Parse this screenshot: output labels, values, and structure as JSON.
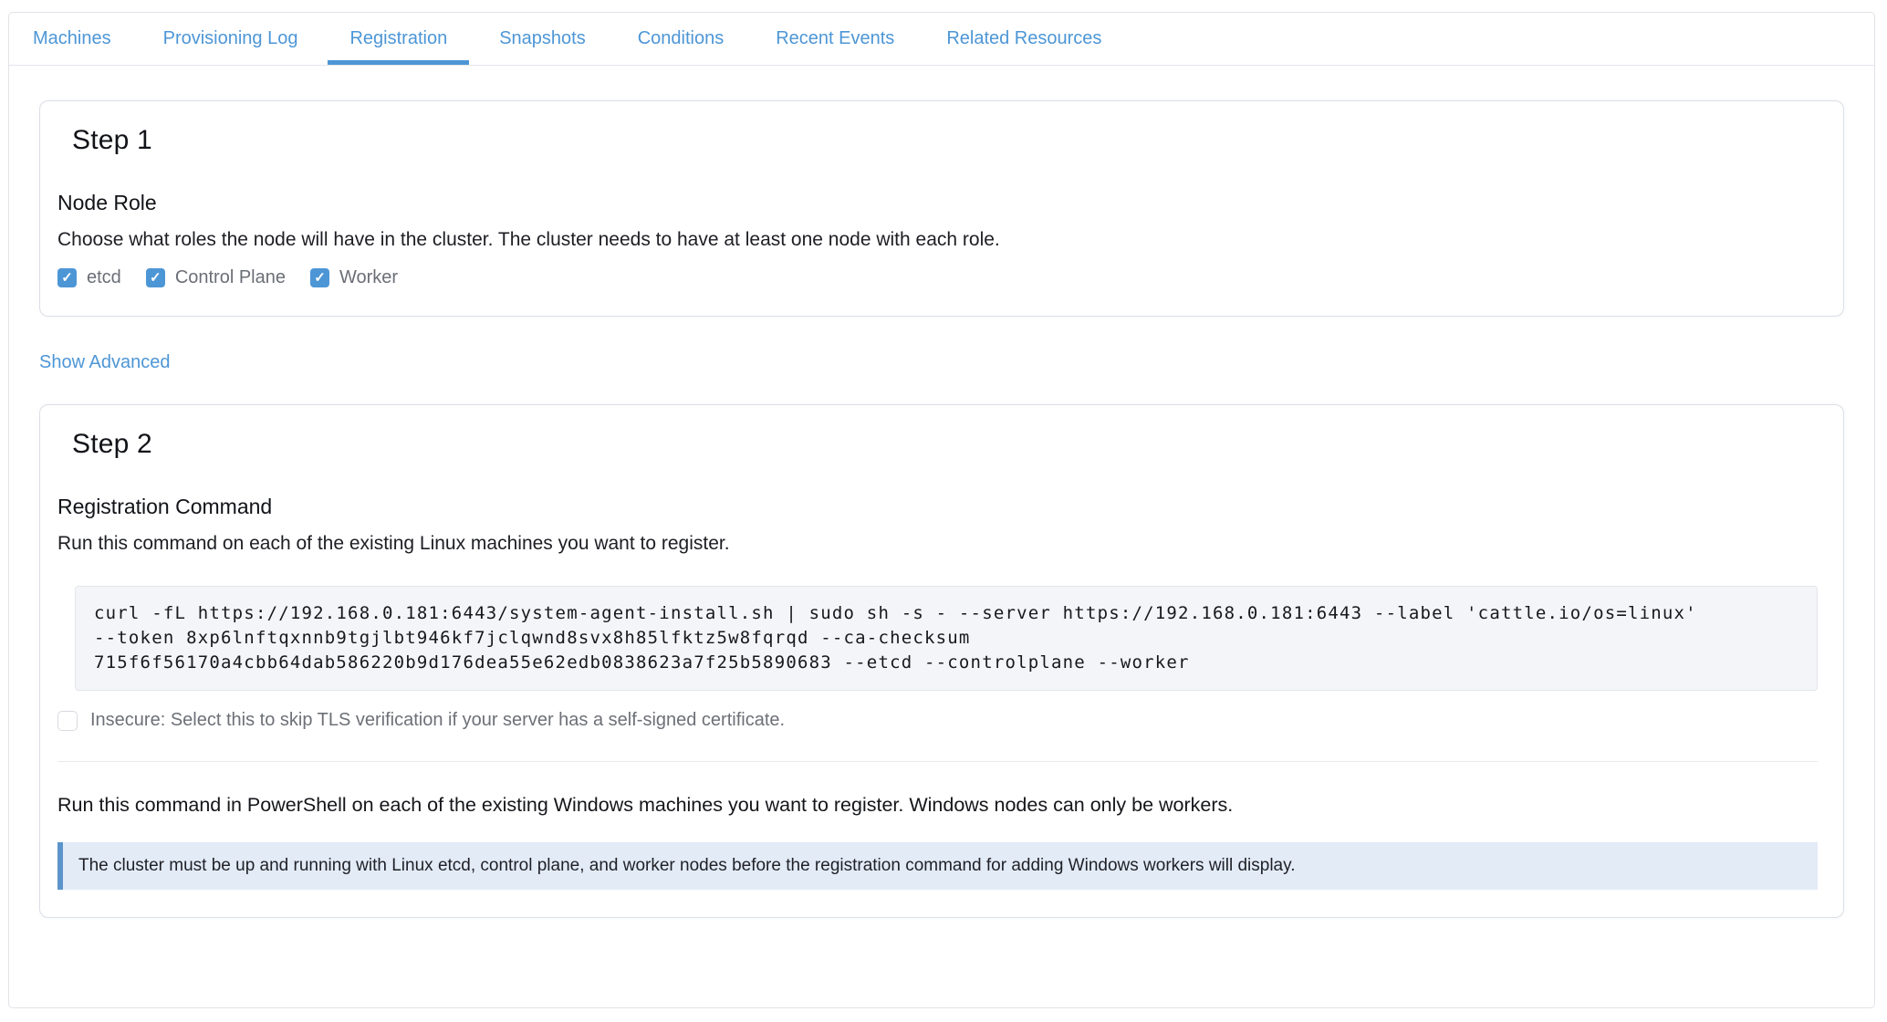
{
  "tabs": [
    {
      "label": "Machines",
      "active": false
    },
    {
      "label": "Provisioning Log",
      "active": false
    },
    {
      "label": "Registration",
      "active": true
    },
    {
      "label": "Snapshots",
      "active": false
    },
    {
      "label": "Conditions",
      "active": false
    },
    {
      "label": "Recent Events",
      "active": false
    },
    {
      "label": "Related Resources",
      "active": false
    }
  ],
  "step1": {
    "title": "Step 1",
    "heading": "Node Role",
    "description": "Choose what roles the node will have in the cluster. The cluster needs to have at least one node with each role.",
    "roles": [
      {
        "label": "etcd",
        "checked": true
      },
      {
        "label": "Control Plane",
        "checked": true
      },
      {
        "label": "Worker",
        "checked": true
      }
    ]
  },
  "advanced_link": "Show Advanced",
  "step2": {
    "title": "Step 2",
    "heading": "Registration Command",
    "linux_instruction": "Run this command on each of the existing Linux machines you want to register.",
    "command_lines": [
      "curl -fL https://192.168.0.181:6443/system-agent-install.sh | sudo sh -s - --server https://192.168.0.181:6443 --label 'cattle.io/os=linux'",
      "--token 8xp6lnftqxnnb9tgjlbt946kf7jclqwnd8svx8h85lfktz5w8fqrqd --ca-checksum",
      "715f6f56170a4cbb64dab586220b9d176dea55e62edb0838623a7f25b5890683 --etcd --controlplane --worker"
    ],
    "insecure": {
      "label": "Insecure: Select this to skip TLS verification if your server has a self-signed certificate.",
      "checked": false
    },
    "windows_instruction": "Run this command in PowerShell on each of the existing Windows machines you want to register. Windows nodes can only be workers.",
    "windows_banner": "The cluster must be up and running with Linux etcd, control plane, and worker nodes before the registration command for adding Windows workers will display."
  },
  "icons": {
    "check_icon": "✓"
  },
  "colors": {
    "accent_blue": "#4d96d6",
    "checkbox_checked": "#4d96d6",
    "banner_bg": "#e3ebf7",
    "banner_border": "#5b94cd",
    "code_bg": "#f4f5f8"
  }
}
